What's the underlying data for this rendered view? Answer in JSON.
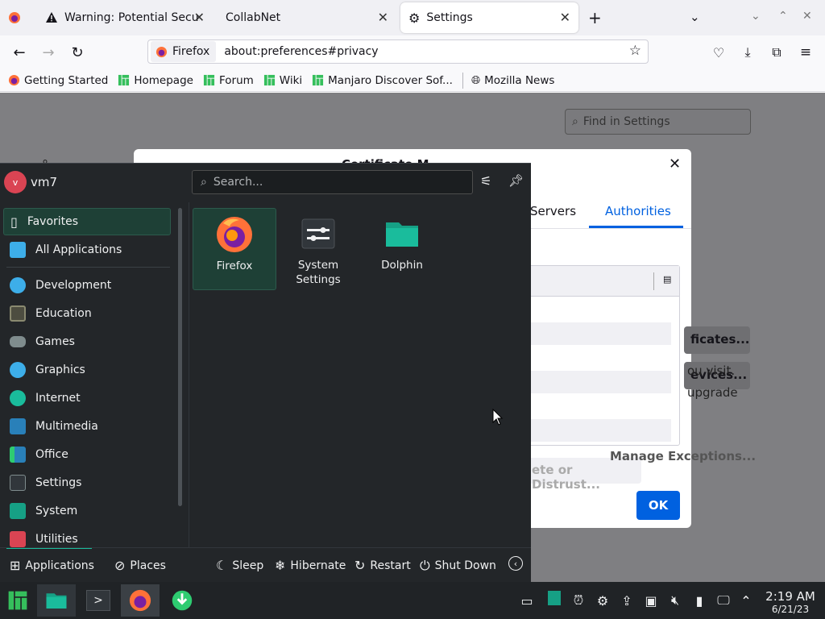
{
  "browser": {
    "tabs": [
      {
        "label": "",
        "icon": "firefox-icon"
      },
      {
        "label": "Warning: Potential Security Risk Ahead",
        "icon": "warning-icon"
      },
      {
        "label": "CollabNet",
        "icon": ""
      },
      {
        "label": "Settings",
        "icon": "gear-icon"
      }
    ],
    "identity_label": "Firefox",
    "url": "about:preferences#privacy",
    "bookmarks": [
      "Getting Started",
      "Homepage",
      "Forum",
      "Wiki",
      "Manjaro Discover Sof...",
      "Mozilla News"
    ]
  },
  "settings": {
    "find_placeholder": "Find in Settings",
    "outside_text_1": "ou visit.",
    "outside_text_2": "upgrade",
    "manage_exceptions": "Manage Exceptions..."
  },
  "certificate_dialog": {
    "title_partial": "Certificate M",
    "tabs": [
      "Servers",
      "Authorities"
    ],
    "active_tab": "Authorities",
    "button_1": "ficates...",
    "button_2": "evices...",
    "delete_button": "ete or Distrust...",
    "ok_button": "OK"
  },
  "kde_menu": {
    "avatar_letter": "v",
    "username": "vm7",
    "search_placeholder": "Search...",
    "sidebar": [
      {
        "label": "Favorites",
        "icon": "bookmark-icon",
        "color": "#eff0f1"
      },
      {
        "label": "All Applications",
        "icon": "grid-icon",
        "color": "#3daee9"
      },
      {
        "label": "Development",
        "icon": "development-icon",
        "color": "#3daee9"
      },
      {
        "label": "Education",
        "icon": "education-icon",
        "color": "#4d4d40"
      },
      {
        "label": "Games",
        "icon": "games-icon",
        "color": "#7f8c8d"
      },
      {
        "label": "Graphics",
        "icon": "graphics-icon",
        "color": "#3daee9"
      },
      {
        "label": "Internet",
        "icon": "internet-icon",
        "color": "#1abc9c"
      },
      {
        "label": "Multimedia",
        "icon": "multimedia-icon",
        "color": "#2980b9"
      },
      {
        "label": "Office",
        "icon": "office-icon",
        "color": "#2ecc71"
      },
      {
        "label": "Settings",
        "icon": "settings-icon",
        "color": "#7f8c8d"
      },
      {
        "label": "System",
        "icon": "system-icon",
        "color": "#16a085"
      },
      {
        "label": "Utilities",
        "icon": "utilities-icon",
        "color": "#da4453"
      }
    ],
    "apps": [
      {
        "label": "Firefox",
        "icon": "firefox-icon"
      },
      {
        "label": "System Settings",
        "icon": "system-settings-icon"
      },
      {
        "label": "Dolphin",
        "icon": "dolphin-icon"
      }
    ],
    "footer": {
      "applications": "Applications",
      "places": "Places",
      "sleep": "Sleep",
      "hibernate": "Hibernate",
      "restart": "Restart",
      "shutdown": "Shut Down"
    }
  },
  "taskbar": {
    "time": "2:19 AM",
    "date": "6/21/23"
  },
  "colors": {
    "accent": "#1abc9c",
    "ok_button": "#0061e0",
    "firefox_tab_bar": "#f0f0f4",
    "kde_panel": "#232629"
  }
}
